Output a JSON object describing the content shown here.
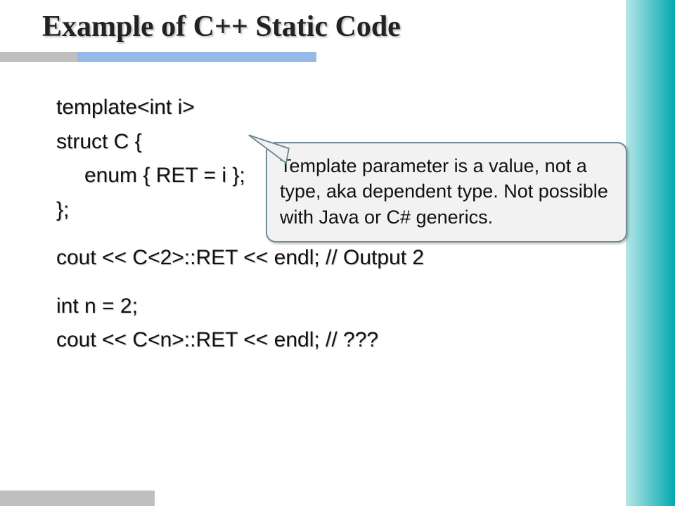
{
  "title": "Example of C++ Static Code",
  "code": {
    "l1": "template<int i>",
    "l2": "struct C {",
    "l3": "enum { RET = i };",
    "l4": "};",
    "l5": "cout << C<2>::RET << endl; // Output 2",
    "l6": "int n = 2;",
    "l7": "cout << C<n>::RET << endl; // ???"
  },
  "callout": "Template parameter is a value, not a type, aka dependent type. Not possible with Java or C# generics."
}
